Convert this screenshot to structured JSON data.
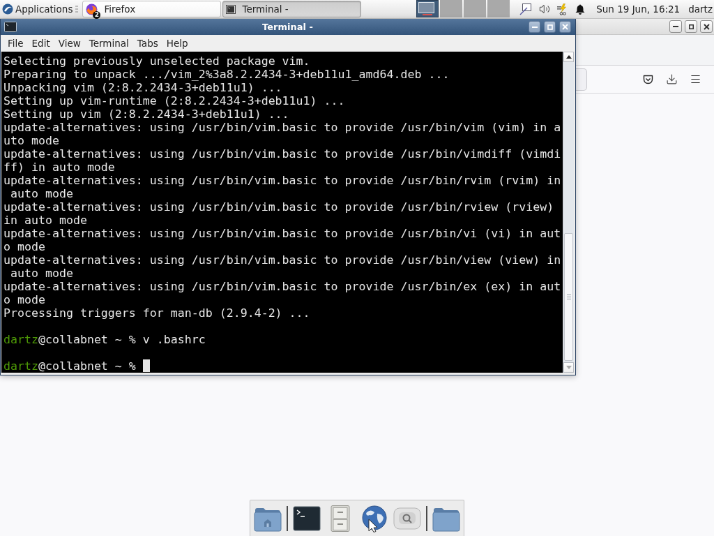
{
  "top_panel": {
    "applications_menu": "Applications",
    "tasks": [
      {
        "label": "Firefox",
        "kind": "browser",
        "badge": "2",
        "selected": false
      },
      {
        "label": "Terminal -",
        "kind": "terminal",
        "selected": true
      }
    ],
    "workspaces": [
      {
        "selected": true
      },
      {
        "selected": false
      },
      {
        "selected": false
      },
      {
        "selected": false
      }
    ],
    "clock": "Sun 19 Jun, 16:21",
    "user": "dartz"
  },
  "terminal_window": {
    "title": "Terminal -",
    "menu": [
      "File",
      "Edit",
      "View",
      "Terminal",
      "Tabs",
      "Help"
    ],
    "lines": [
      {
        "kind": "output",
        "text": "Selecting previously unselected package vim."
      },
      {
        "kind": "output",
        "text": "Preparing to unpack .../vim_2%3a8.2.2434-3+deb11u1_amd64.deb ..."
      },
      {
        "kind": "output",
        "text": "Unpacking vim (2:8.2.2434-3+deb11u1) ..."
      },
      {
        "kind": "output",
        "text": "Setting up vim-runtime (2:8.2.2434-3+deb11u1) ..."
      },
      {
        "kind": "output",
        "text": "Setting up vim (2:8.2.2434-3+deb11u1) ..."
      },
      {
        "kind": "output",
        "text": "update-alternatives: using /usr/bin/vim.basic to provide /usr/bin/vim (vim) in auto mode"
      },
      {
        "kind": "output",
        "text": "update-alternatives: using /usr/bin/vim.basic to provide /usr/bin/vimdiff (vimdiff) in auto mode"
      },
      {
        "kind": "output",
        "text": "update-alternatives: using /usr/bin/vim.basic to provide /usr/bin/rvim (rvim) in auto mode"
      },
      {
        "kind": "output",
        "text": "update-alternatives: using /usr/bin/vim.basic to provide /usr/bin/rview (rview) in auto mode"
      },
      {
        "kind": "output",
        "text": "update-alternatives: using /usr/bin/vim.basic to provide /usr/bin/vi (vi) in auto mode"
      },
      {
        "kind": "output",
        "text": "update-alternatives: using /usr/bin/vim.basic to provide /usr/bin/view (view) in auto mode"
      },
      {
        "kind": "output",
        "text": "update-alternatives: using /usr/bin/vim.basic to provide /usr/bin/ex (ex) in auto mode"
      },
      {
        "kind": "output",
        "text": "Processing triggers for man-db (2.9.4-2) ..."
      },
      {
        "kind": "blank"
      },
      {
        "kind": "prompt",
        "user": "dartz",
        "text": "@collabnet ~ % v .bashrc",
        "cursor": false
      },
      {
        "kind": "blank"
      },
      {
        "kind": "prompt",
        "user": "dartz",
        "text": "@collabnet ~ %",
        "cursor": true
      }
    ]
  }
}
